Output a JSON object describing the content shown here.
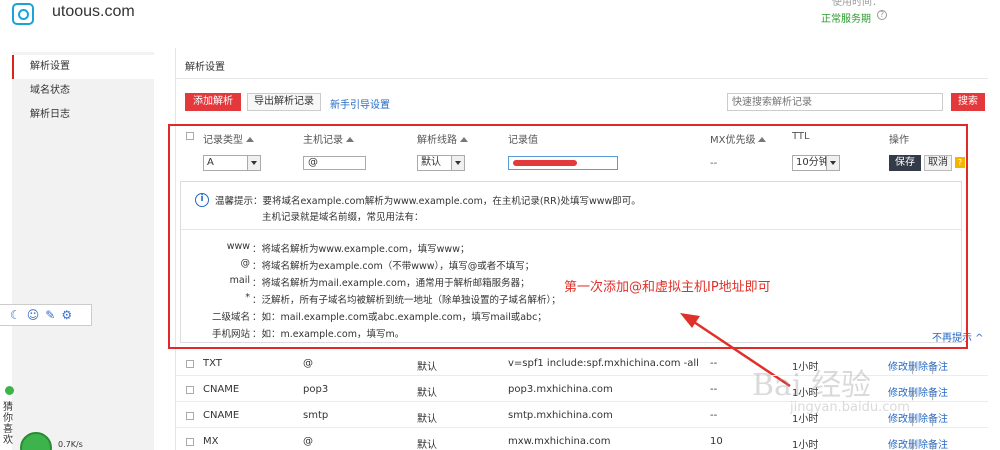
{
  "header": {
    "site": "utoous.com",
    "top_right_label": "使用时间：",
    "status": "正常服务期"
  },
  "sidebar": {
    "items": [
      {
        "label": "解析设置",
        "active": true
      },
      {
        "label": "域名状态",
        "active": false
      },
      {
        "label": "解析日志",
        "active": false
      }
    ]
  },
  "left_widgets": {
    "vertical_text": "猜你喜欢",
    "speed": "0.7K/s"
  },
  "main": {
    "title": "解析设置",
    "add_button": "添加解析",
    "export_button": "导出解析记录",
    "guide_link": "新手引导设置",
    "search_placeholder": "快速搜索解析记录",
    "search_button": "搜索"
  },
  "table": {
    "headers": [
      "记录类型",
      "主机记录",
      "解析线路",
      "记录值",
      "MX优先级",
      "TTL",
      "操作"
    ],
    "edit_row": {
      "type": "A",
      "host": "@",
      "line": "默认",
      "mx": "--",
      "ttl": "10分钟",
      "save": "保存",
      "cancel": "取消",
      "help": "?"
    },
    "rows": [
      {
        "type": "TXT",
        "host": "@",
        "line": "默认",
        "value": "v=spf1 include:spf.mxhichina.com -all",
        "mx": "--",
        "ttl": "1小时"
      },
      {
        "type": "CNAME",
        "host": "pop3",
        "line": "默认",
        "value": "pop3.mxhichina.com",
        "mx": "--",
        "ttl": "1小时"
      },
      {
        "type": "CNAME",
        "host": "smtp",
        "line": "默认",
        "value": "smtp.mxhichina.com",
        "mx": "--",
        "ttl": "1小时"
      },
      {
        "type": "MX",
        "host": "@",
        "line": "默认",
        "value": "mxw.mxhichina.com",
        "mx": "10",
        "ttl": "1小时"
      }
    ],
    "row_actions": {
      "edit": "修改",
      "delete": "删除",
      "note": "备注"
    }
  },
  "tips": {
    "line1": "温馨提示：要将域名example.com解析为www.example.com，在主机记录(RR)处填写www即可。",
    "line2": "主机记录就是域名前缀，常见用法有：",
    "examples": [
      {
        "label": "www",
        "text": "：将域名解析为www.example.com，填写www；"
      },
      {
        "label": "@",
        "text": "：将域名解析为example.com（不带www），填写@或者不填写；"
      },
      {
        "label": "mail",
        "text": "：将域名解析为mail.example.com，通常用于解析邮箱服务器；"
      },
      {
        "label": "*",
        "text": "：泛解析，所有子域名均被解析到统一地址（除单独设置的子域名解析）；"
      },
      {
        "label": "二级域名",
        "text": "：如：mail.example.com或abc.example.com，填写mail或abc；"
      },
      {
        "label": "手机网站",
        "text": "：如：m.example.com，填写m。"
      }
    ],
    "hide_link": "不再提示 ^"
  },
  "annotation": "第一次添加@和虚拟主机IP地址即可",
  "watermark": {
    "main": "Bai 经验",
    "sub": "jingyan.baidu.com"
  },
  "colors": {
    "accent_red": "#e4393c",
    "link_blue": "#2569c7",
    "status_green": "#2a9a2a",
    "frame_red": "#e02a2a"
  }
}
